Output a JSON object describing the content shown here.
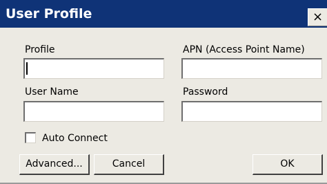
{
  "window": {
    "title": "User Profile",
    "close_label": "×"
  },
  "form": {
    "profile_label": "Profile",
    "profile_value": "",
    "apn_label": "APN (Access Point Name)",
    "apn_value": "",
    "username_label": "User Name",
    "username_value": "",
    "password_label": "Password",
    "password_value": "",
    "auto_connect_label": "Auto Connect",
    "auto_connect_checked": false
  },
  "buttons": {
    "advanced_label": "Advanced...",
    "cancel_label": "Cancel",
    "ok_label": "OK"
  }
}
